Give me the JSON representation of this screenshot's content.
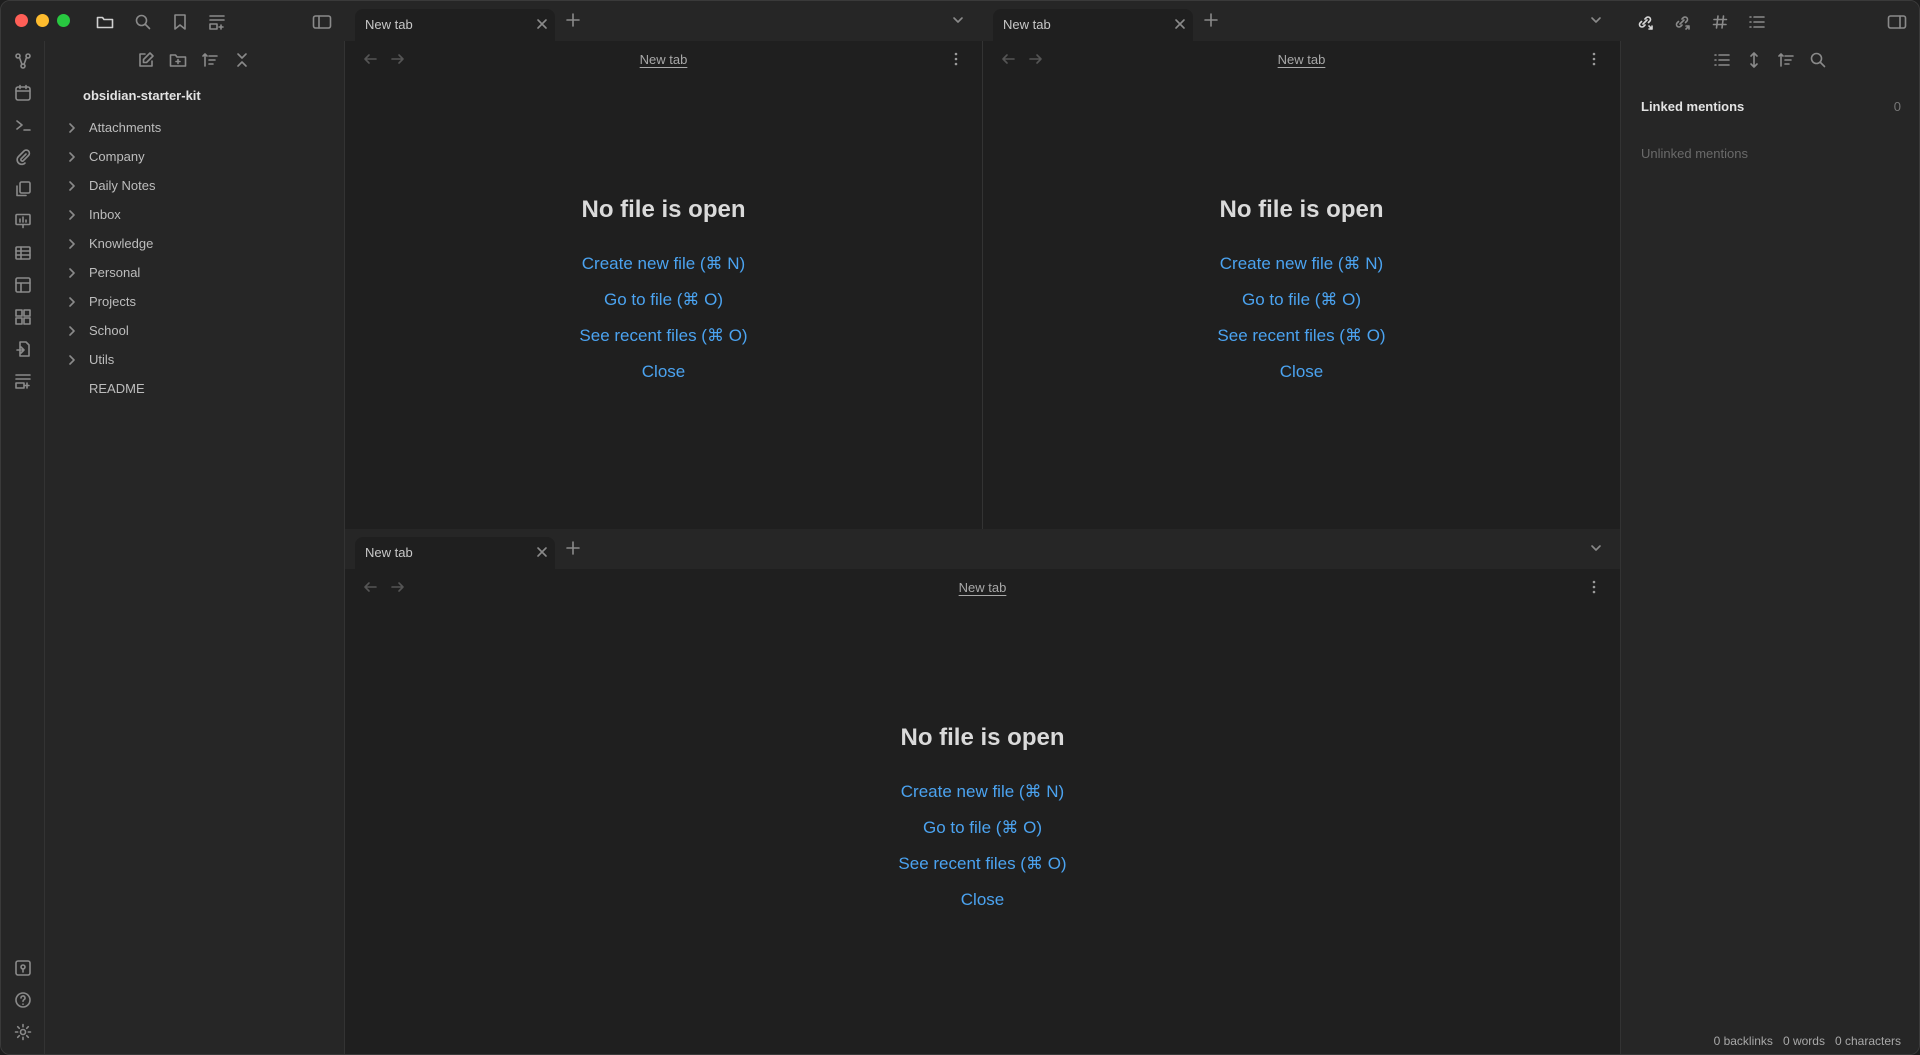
{
  "window": {
    "traffic_colors": [
      "#ff5f57",
      "#febc2e",
      "#28c840"
    ]
  },
  "top_icons": {
    "left": [
      "folder-icon",
      "search-icon",
      "bookmark-icon",
      "new-tab-list-icon",
      "sidebar-toggle-icon"
    ],
    "right": [
      "backlinks-icon",
      "outgoing-links-icon",
      "tags-icon",
      "outline-icon",
      "right-sidebar-toggle-icon"
    ]
  },
  "ribbon": {
    "icons": [
      "graph-icon",
      "calendar-icon",
      "terminal-icon",
      "paperclip-icon",
      "copy-icon",
      "slides-icon",
      "table-icon",
      "layout-icon",
      "extensions-icon",
      "export-icon",
      "inbox-icon"
    ],
    "bottom_icons": [
      "vault-icon",
      "help-icon",
      "settings-icon"
    ]
  },
  "file_explorer": {
    "vault_name": "obsidian-starter-kit",
    "folders": [
      "Attachments",
      "Company",
      "Daily Notes",
      "Inbox",
      "Knowledge",
      "Personal",
      "Projects",
      "School",
      "Utils"
    ],
    "files": [
      "README"
    ]
  },
  "panes": [
    {
      "tab_label": "New tab",
      "view_title": "New tab",
      "empty": {
        "title": "No file is open",
        "create": "Create new file (⌘ N)",
        "goto": "Go to file (⌘ O)",
        "recent": "See recent files (⌘ O)",
        "close": "Close"
      }
    },
    {
      "tab_label": "New tab",
      "view_title": "New tab",
      "empty": {
        "title": "No file is open",
        "create": "Create new file (⌘ N)",
        "goto": "Go to file (⌘ O)",
        "recent": "See recent files (⌘ O)",
        "close": "Close"
      }
    },
    {
      "tab_label": "New tab",
      "view_title": "New tab",
      "empty": {
        "title": "No file is open",
        "create": "Create new file (⌘ N)",
        "goto": "Go to file (⌘ O)",
        "recent": "See recent files (⌘ O)",
        "close": "Close"
      }
    }
  ],
  "backlinks": {
    "linked_label": "Linked mentions",
    "linked_count": "0",
    "unlinked_label": "Unlinked mentions"
  },
  "status_bar": {
    "backlinks": "0 backlinks",
    "words": "0 words",
    "characters": "0 characters"
  }
}
